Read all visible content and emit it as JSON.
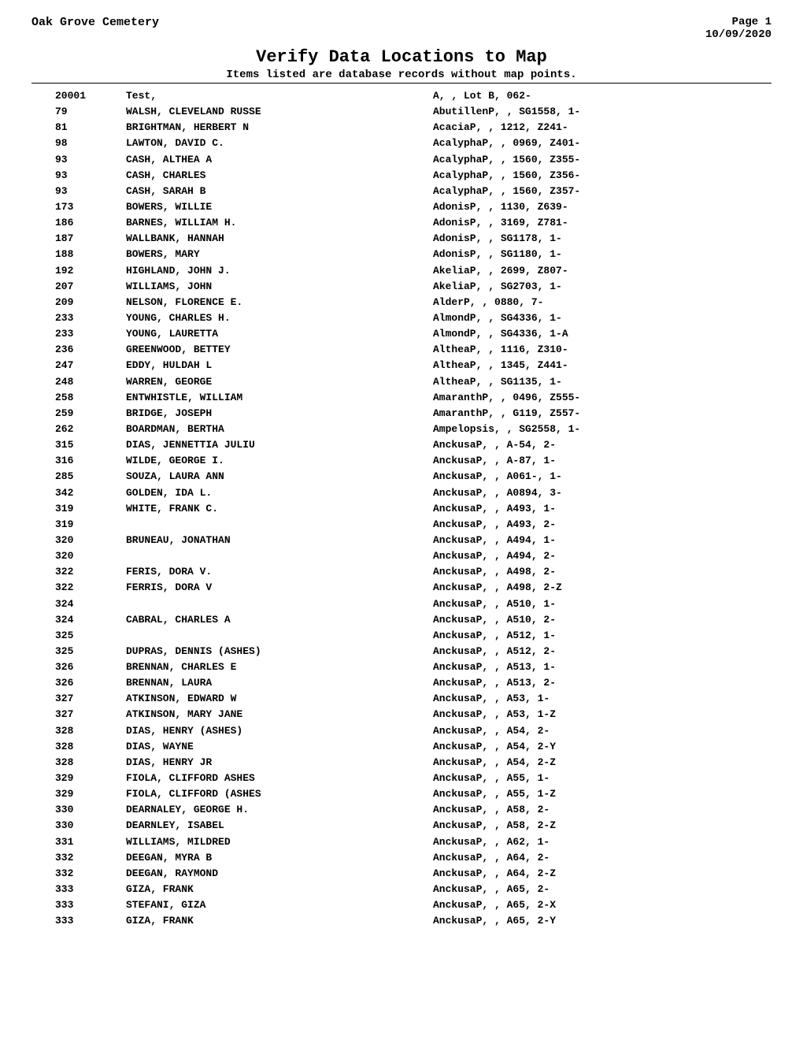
{
  "header": {
    "cemetery": "Oak Grove Cemetery",
    "page": "Page 1",
    "date": "10/09/2020"
  },
  "title": "Verify Data Locations to Map",
  "subtitle": "Items listed are database records without map points.",
  "records": [
    {
      "id": "20001",
      "name": "Test,",
      "loc": "A, , Lot B, 062-"
    },
    {
      "id": "79",
      "name": "WALSH, CLEVELAND RUSSE",
      "loc": "AbutillenP, , SG1558, 1-"
    },
    {
      "id": "81",
      "name": "BRIGHTMAN, HERBERT N",
      "loc": "AcaciaP, , 1212, Z241-"
    },
    {
      "id": "98",
      "name": "LAWTON, DAVID C.",
      "loc": "AcalyphaP, , 0969, Z401-"
    },
    {
      "id": "93",
      "name": "CASH, ALTHEA A",
      "loc": "AcalyphaP, , 1560, Z355-"
    },
    {
      "id": "93",
      "name": "CASH, CHARLES",
      "loc": "AcalyphaP, , 1560, Z356-"
    },
    {
      "id": "93",
      "name": "CASH, SARAH B",
      "loc": "AcalyphaP, , 1560, Z357-"
    },
    {
      "id": "173",
      "name": "BOWERS, WILLIE",
      "loc": "AdonisP, , 1130, Z639-"
    },
    {
      "id": "186",
      "name": "BARNES, WILLIAM H.",
      "loc": "AdonisP, , 3169, Z781-"
    },
    {
      "id": "187",
      "name": "WALLBANK, HANNAH",
      "loc": "AdonisP, , SG1178, 1-"
    },
    {
      "id": "188",
      "name": "BOWERS, MARY",
      "loc": "AdonisP, , SG1180, 1-"
    },
    {
      "id": "192",
      "name": "HIGHLAND, JOHN J.",
      "loc": "AkeliaP, , 2699, Z807-"
    },
    {
      "id": "207",
      "name": "WILLIAMS, JOHN",
      "loc": "AkeliaP, , SG2703, 1-"
    },
    {
      "id": "209",
      "name": "NELSON, FLORENCE E.",
      "loc": "AlderP, , 0880, 7-"
    },
    {
      "id": "233",
      "name": "YOUNG, CHARLES H.",
      "loc": "AlmondP, , SG4336, 1-"
    },
    {
      "id": "233",
      "name": "YOUNG, LAURETTA",
      "loc": "AlmondP, , SG4336, 1-A"
    },
    {
      "id": "236",
      "name": "GREENWOOD, BETTEY",
      "loc": "AltheaP, , 1116, Z310-"
    },
    {
      "id": "247",
      "name": "EDDY, HULDAH L",
      "loc": "AltheaP, , 1345, Z441-"
    },
    {
      "id": "248",
      "name": "WARREN, GEORGE",
      "loc": "AltheaP, , SG1135, 1-"
    },
    {
      "id": "258",
      "name": "ENTWHISTLE, WILLIAM",
      "loc": "AmaranthP, , 0496, Z555-"
    },
    {
      "id": "259",
      "name": "BRIDGE, JOSEPH",
      "loc": "AmaranthP, , G119, Z557-"
    },
    {
      "id": "262",
      "name": "BOARDMAN, BERTHA",
      "loc": "Ampelopsis, , SG2558, 1-"
    },
    {
      "id": "315",
      "name": "DIAS, JENNETTIA JULIU",
      "loc": "AnckusaP, , A-54, 2-"
    },
    {
      "id": "316",
      "name": "WILDE, GEORGE I.",
      "loc": "AnckusaP, , A-87, 1-"
    },
    {
      "id": "285",
      "name": "SOUZA, LAURA ANN",
      "loc": "AnckusaP, , A061-, 1-"
    },
    {
      "id": "342",
      "name": "GOLDEN, IDA L.",
      "loc": "AnckusaP, , A0894, 3-"
    },
    {
      "id": "319",
      "name": "WHITE, FRANK C.",
      "loc": "AnckusaP, , A493, 1-"
    },
    {
      "id": "319",
      "name": "",
      "loc": "AnckusaP, , A493, 2-"
    },
    {
      "id": "320",
      "name": "BRUNEAU, JONATHAN",
      "loc": "AnckusaP, , A494, 1-"
    },
    {
      "id": "320",
      "name": "",
      "loc": "AnckusaP, , A494, 2-"
    },
    {
      "id": "322",
      "name": "FERIS, DORA V.",
      "loc": "AnckusaP, , A498, 2-"
    },
    {
      "id": "322",
      "name": "FERRIS, DORA V",
      "loc": "AnckusaP, , A498, 2-Z"
    },
    {
      "id": "324",
      "name": "",
      "loc": "AnckusaP, , A510, 1-"
    },
    {
      "id": "324",
      "name": "CABRAL, CHARLES A",
      "loc": "AnckusaP, , A510, 2-"
    },
    {
      "id": "325",
      "name": "",
      "loc": "AnckusaP, , A512, 1-"
    },
    {
      "id": "325",
      "name": "DUPRAS, DENNIS (ASHES)",
      "loc": "AnckusaP, , A512, 2-"
    },
    {
      "id": "326",
      "name": "BRENNAN, CHARLES E",
      "loc": "AnckusaP, , A513, 1-"
    },
    {
      "id": "326",
      "name": "BRENNAN, LAURA",
      "loc": "AnckusaP, , A513, 2-"
    },
    {
      "id": "327",
      "name": "ATKINSON, EDWARD W",
      "loc": "AnckusaP, , A53, 1-"
    },
    {
      "id": "327",
      "name": "ATKINSON, MARY JANE",
      "loc": "AnckusaP, , A53, 1-Z"
    },
    {
      "id": "328",
      "name": "DIAS, HENRY (ASHES)",
      "loc": "AnckusaP, , A54, 2-"
    },
    {
      "id": "328",
      "name": "DIAS, WAYNE",
      "loc": "AnckusaP, , A54, 2-Y"
    },
    {
      "id": "328",
      "name": "DIAS, HENRY JR",
      "loc": "AnckusaP, , A54, 2-Z"
    },
    {
      "id": "329",
      "name": "FIOLA, CLIFFORD ASHES",
      "loc": "AnckusaP, , A55, 1-"
    },
    {
      "id": "329",
      "name": "FIOLA, CLIFFORD (ASHES",
      "loc": "AnckusaP, , A55, 1-Z"
    },
    {
      "id": "330",
      "name": "DEARNALEY, GEORGE H.",
      "loc": "AnckusaP, , A58, 2-"
    },
    {
      "id": "330",
      "name": "DEARNLEY, ISABEL",
      "loc": "AnckusaP, , A58, 2-Z"
    },
    {
      "id": "331",
      "name": "WILLIAMS, MILDRED",
      "loc": "AnckusaP, , A62, 1-"
    },
    {
      "id": "332",
      "name": "DEEGAN, MYRA B",
      "loc": "AnckusaP, , A64, 2-"
    },
    {
      "id": "332",
      "name": "DEEGAN, RAYMOND",
      "loc": "AnckusaP, , A64, 2-Z"
    },
    {
      "id": "333",
      "name": "GIZA, FRANK",
      "loc": "AnckusaP, , A65, 2-"
    },
    {
      "id": "333",
      "name": "STEFANI, GIZA",
      "loc": "AnckusaP, , A65, 2-X"
    },
    {
      "id": "333",
      "name": "GIZA, FRANK",
      "loc": "AnckusaP, , A65, 2-Y"
    }
  ]
}
